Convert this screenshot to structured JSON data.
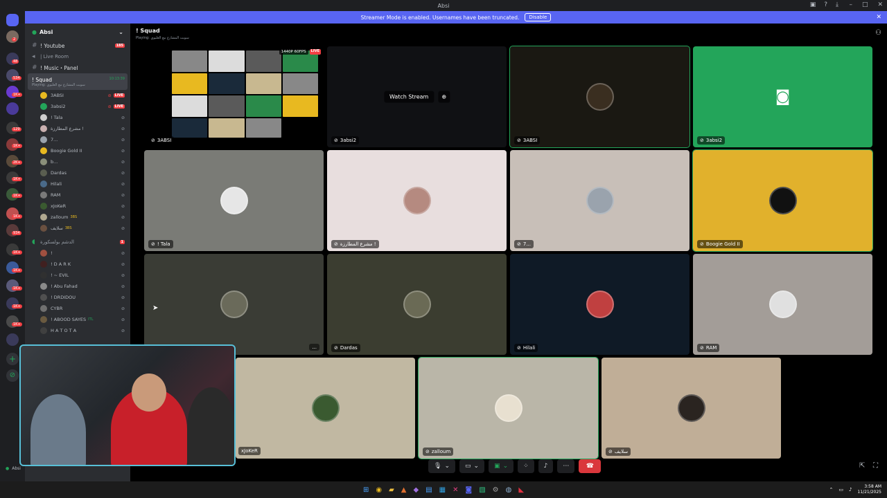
{
  "window": {
    "title": "Absi"
  },
  "banner": {
    "text": "Streamer Mode is enabled. Usernames have been truncated.",
    "button": "Disable"
  },
  "rail_badges": [
    "2",
    "48",
    "534",
    "1K+",
    "129",
    "1K+",
    "2K+",
    "1K+",
    "1K+",
    "1K+",
    "934",
    "1K+",
    "1K+",
    "1K+",
    "1K+",
    "1K+"
  ],
  "server": {
    "name": "Absi"
  },
  "sidebar": {
    "youtube": {
      "label": "! Youtube",
      "badge": "185"
    },
    "live_room": "| Live Room",
    "music": "! Music・Panel",
    "squad": {
      "label": "! Squad",
      "timer": "10:13:39",
      "activity": "Playing: سوبت المشارع مع العليوي"
    },
    "squad_users": [
      {
        "name": "3ABSI",
        "live": "LIVE",
        "color": "#e8b920"
      },
      {
        "name": "3absi2",
        "live": "LIVE",
        "color": "#23a55a"
      },
      {
        "name": "! Tala",
        "live": "",
        "color": "#cfcfcf"
      },
      {
        "name": "مشرع المطارزة !",
        "live": "",
        "color": "#c9b0b0"
      },
      {
        "name": "7...",
        "live": "",
        "color": "#9aa3ad"
      },
      {
        "name": "Boogie Gold II",
        "live": "",
        "color": "#e8b920"
      },
      {
        "name": "b...",
        "live": "",
        "color": "#8a8f7a"
      },
      {
        "name": "Dardas",
        "live": "",
        "color": "#5a5e50"
      },
      {
        "name": "Hilali",
        "live": "",
        "color": "#4a6a8a"
      },
      {
        "name": "RAM",
        "live": "",
        "color": "#7a7a7a"
      },
      {
        "name": "xJoKeR",
        "live": "",
        "color": "#3a5a30"
      },
      {
        "name": "zalloum",
        "live": "",
        "tag": "3BS",
        "color": "#b0a890"
      },
      {
        "name": "سلايف",
        "live": "",
        "tag": "3BS",
        "color": "#6a5040"
      }
    ],
    "lounge": {
      "label": "الدشم بولسكورة",
      "badge": "1"
    },
    "lounge_users": [
      {
        "name": "!",
        "color": "#a05040"
      },
      {
        "name": "! D A R K",
        "color": "#402020"
      },
      {
        "name": "! ~ EVIL",
        "color": "#303030"
      },
      {
        "name": "! Abu Fahad",
        "color": "#8a8a8a"
      },
      {
        "name": "! DRDIDOU",
        "color": "#505050"
      },
      {
        "name": "CYBR",
        "color": "#707070"
      },
      {
        "name": "! ABOOD SAYES",
        "tag": "ITL",
        "color": "#6a5a40"
      },
      {
        "name": "H A T O T A",
        "color": "#404040"
      }
    ]
  },
  "voice": {
    "channel": "! Squad",
    "activity": "Playing: سوبت المشارع مع العليوي",
    "stream_quality": "1440P 60FPS",
    "live": "LIVE",
    "watch_stream": "Watch Stream",
    "tiles": [
      {
        "name": "3ABSI",
        "bg": "#000000",
        "type": "stream"
      },
      {
        "name": "3absi2",
        "bg": "#101114",
        "type": "watch"
      },
      {
        "name": "3ABSI",
        "bg": "#1a1812",
        "type": "avatar",
        "avatar_color": "#3a2e20",
        "speaking": true
      },
      {
        "name": "3absi2",
        "bg": "#23a55a",
        "type": "discord"
      },
      {
        "name": "! Tala",
        "bg": "#7a7b76",
        "type": "avatar",
        "avatar_color": "#e6e6e6"
      },
      {
        "name": "مشرع المطارزة !",
        "bg": "#e8dede",
        "type": "avatar",
        "avatar_color": "#b58a80"
      },
      {
        "name": "7...",
        "bg": "#c8bfb8",
        "type": "avatar",
        "avatar_color": "#9aa3ad"
      },
      {
        "name": "Boogie Gold II",
        "bg": "#e1b12c",
        "type": "avatar",
        "avatar_color": "#111111",
        "speaking": true
      },
      {
        "name": "",
        "bg": "#3a3c35",
        "type": "avatar",
        "avatar_color": "#6a6a5a"
      },
      {
        "name": "Dardas",
        "bg": "#3b3d30",
        "type": "avatar",
        "avatar_color": "#6a6a55"
      },
      {
        "name": "Hilali",
        "bg": "#0f1a26",
        "type": "avatar",
        "avatar_color": "#c04040"
      },
      {
        "name": "RAM",
        "bg": "#a39d98",
        "type": "avatar",
        "avatar_color": "#e0e0e0"
      },
      {
        "name": "xJoKeR",
        "bg": "#c1b8a2",
        "type": "avatar",
        "avatar_color": "#3a5a30"
      },
      {
        "name": "zalloum",
        "bg": "#bab6a8",
        "type": "avatar",
        "avatar_color": "#e8e0d0",
        "speaking": true
      },
      {
        "name": "سلايف",
        "bg": "#c0ae97",
        "type": "avatar",
        "avatar_color": "#2a2420"
      }
    ],
    "more": "..."
  },
  "user_panel": {
    "name": "Absi"
  },
  "clock": {
    "time": "3:58 AM",
    "date": "11/21/2025"
  }
}
